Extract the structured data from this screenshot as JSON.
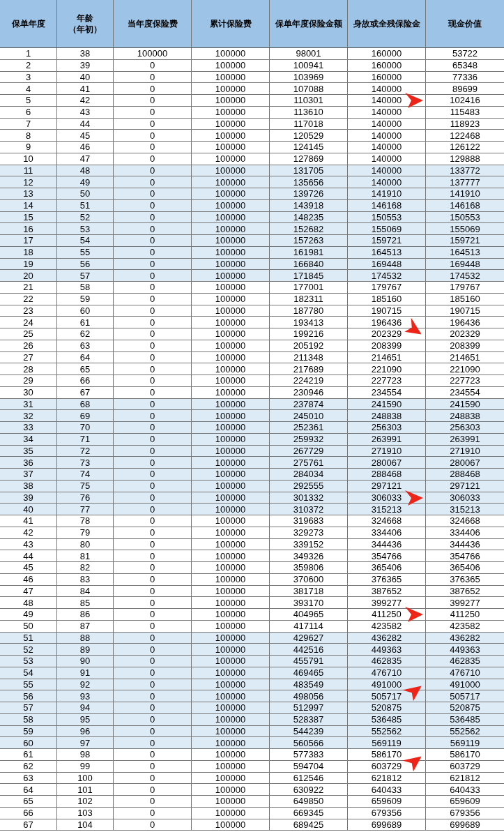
{
  "columns": [
    {
      "label": "保单年度"
    },
    {
      "label": "年龄",
      "sublabel": "（年初）"
    },
    {
      "label": "当年度保险费"
    },
    {
      "label": "累计保险费"
    },
    {
      "label": "保单年度保险金额"
    },
    {
      "label": "身故或全残保险金"
    },
    {
      "label": "现金价值"
    }
  ],
  "rows": [
    {
      "cells": [
        "1",
        "38",
        "100000",
        "100000",
        "98001",
        "160000",
        "53722"
      ],
      "shaded": false
    },
    {
      "cells": [
        "2",
        "39",
        "0",
        "100000",
        "100941",
        "160000",
        "65348"
      ],
      "shaded": false
    },
    {
      "cells": [
        "3",
        "40",
        "0",
        "100000",
        "103969",
        "160000",
        "77336"
      ],
      "shaded": false
    },
    {
      "cells": [
        "4",
        "41",
        "0",
        "100000",
        "107088",
        "140000",
        "89699"
      ],
      "shaded": false
    },
    {
      "cells": [
        "5",
        "42",
        "0",
        "100000",
        "110301",
        "140000",
        "102416"
      ],
      "shaded": false,
      "arrow": {
        "kind": "right"
      }
    },
    {
      "cells": [
        "6",
        "43",
        "0",
        "100000",
        "113610",
        "140000",
        "115483"
      ],
      "shaded": false
    },
    {
      "cells": [
        "7",
        "44",
        "0",
        "100000",
        "117018",
        "140000",
        "118923"
      ],
      "shaded": false
    },
    {
      "cells": [
        "8",
        "45",
        "0",
        "100000",
        "120529",
        "140000",
        "122468"
      ],
      "shaded": false
    },
    {
      "cells": [
        "9",
        "46",
        "0",
        "100000",
        "124145",
        "140000",
        "126122"
      ],
      "shaded": false
    },
    {
      "cells": [
        "10",
        "47",
        "0",
        "100000",
        "127869",
        "140000",
        "129888"
      ],
      "shaded": false
    },
    {
      "cells": [
        "11",
        "48",
        "0",
        "100000",
        "131705",
        "140000",
        "133772"
      ],
      "shaded": true
    },
    {
      "cells": [
        "12",
        "49",
        "0",
        "100000",
        "135656",
        "140000",
        "137777"
      ],
      "shaded": true
    },
    {
      "cells": [
        "13",
        "50",
        "0",
        "100000",
        "139726",
        "141910",
        "141910"
      ],
      "shaded": true
    },
    {
      "cells": [
        "14",
        "51",
        "0",
        "100000",
        "143918",
        "146168",
        "146168"
      ],
      "shaded": true
    },
    {
      "cells": [
        "15",
        "52",
        "0",
        "100000",
        "148235",
        "150553",
        "150553"
      ],
      "shaded": true
    },
    {
      "cells": [
        "16",
        "53",
        "0",
        "100000",
        "152682",
        "155069",
        "155069"
      ],
      "shaded": true
    },
    {
      "cells": [
        "17",
        "54",
        "0",
        "100000",
        "157263",
        "159721",
        "159721"
      ],
      "shaded": true
    },
    {
      "cells": [
        "18",
        "55",
        "0",
        "100000",
        "161981",
        "164513",
        "164513"
      ],
      "shaded": true
    },
    {
      "cells": [
        "19",
        "56",
        "0",
        "100000",
        "166840",
        "169448",
        "169448"
      ],
      "shaded": true
    },
    {
      "cells": [
        "20",
        "57",
        "0",
        "100000",
        "171845",
        "174532",
        "174532"
      ],
      "shaded": true
    },
    {
      "cells": [
        "21",
        "58",
        "0",
        "100000",
        "177001",
        "179767",
        "179767"
      ],
      "shaded": false
    },
    {
      "cells": [
        "22",
        "59",
        "0",
        "100000",
        "182311",
        "185160",
        "185160"
      ],
      "shaded": false
    },
    {
      "cells": [
        "23",
        "60",
        "0",
        "100000",
        "187780",
        "190715",
        "190715"
      ],
      "shaded": false
    },
    {
      "cells": [
        "24",
        "61",
        "0",
        "100000",
        "193413",
        "196436",
        "196436"
      ],
      "shaded": false
    },
    {
      "cells": [
        "25",
        "62",
        "0",
        "100000",
        "199216",
        "202329",
        "202329"
      ],
      "shaded": false,
      "arrow": {
        "kind": "downright"
      }
    },
    {
      "cells": [
        "26",
        "63",
        "0",
        "100000",
        "205192",
        "208399",
        "208399"
      ],
      "shaded": false
    },
    {
      "cells": [
        "27",
        "64",
        "0",
        "100000",
        "211348",
        "214651",
        "214651"
      ],
      "shaded": false
    },
    {
      "cells": [
        "28",
        "65",
        "0",
        "100000",
        "217689",
        "221090",
        "221090"
      ],
      "shaded": false
    },
    {
      "cells": [
        "29",
        "66",
        "0",
        "100000",
        "224219",
        "227723",
        "227723"
      ],
      "shaded": false
    },
    {
      "cells": [
        "30",
        "67",
        "0",
        "100000",
        "230946",
        "234554",
        "234554"
      ],
      "shaded": false
    },
    {
      "cells": [
        "31",
        "68",
        "0",
        "100000",
        "237874",
        "241590",
        "241590"
      ],
      "shaded": true
    },
    {
      "cells": [
        "32",
        "69",
        "0",
        "100000",
        "245010",
        "248838",
        "248838"
      ],
      "shaded": true
    },
    {
      "cells": [
        "33",
        "70",
        "0",
        "100000",
        "252361",
        "256303",
        "256303"
      ],
      "shaded": true
    },
    {
      "cells": [
        "34",
        "71",
        "0",
        "100000",
        "259932",
        "263991",
        "263991"
      ],
      "shaded": true
    },
    {
      "cells": [
        "35",
        "72",
        "0",
        "100000",
        "267729",
        "271910",
        "271910"
      ],
      "shaded": true
    },
    {
      "cells": [
        "36",
        "73",
        "0",
        "100000",
        "275761",
        "280067",
        "280067"
      ],
      "shaded": true
    },
    {
      "cells": [
        "37",
        "74",
        "0",
        "100000",
        "284034",
        "288468",
        "288468"
      ],
      "shaded": true
    },
    {
      "cells": [
        "38",
        "75",
        "0",
        "100000",
        "292555",
        "297121",
        "297121"
      ],
      "shaded": true
    },
    {
      "cells": [
        "39",
        "76",
        "0",
        "100000",
        "301332",
        "306033",
        "306033"
      ],
      "shaded": true,
      "arrow": {
        "kind": "right"
      }
    },
    {
      "cells": [
        "40",
        "77",
        "0",
        "100000",
        "310372",
        "315213",
        "315213"
      ],
      "shaded": true
    },
    {
      "cells": [
        "41",
        "78",
        "0",
        "100000",
        "319683",
        "324668",
        "324668"
      ],
      "shaded": false
    },
    {
      "cells": [
        "42",
        "79",
        "0",
        "100000",
        "329273",
        "334406",
        "334406"
      ],
      "shaded": false
    },
    {
      "cells": [
        "43",
        "80",
        "0",
        "100000",
        "339152",
        "344436",
        "344436"
      ],
      "shaded": false
    },
    {
      "cells": [
        "44",
        "81",
        "0",
        "100000",
        "349326",
        "354766",
        "354766"
      ],
      "shaded": false
    },
    {
      "cells": [
        "45",
        "82",
        "0",
        "100000",
        "359806",
        "365406",
        "365406"
      ],
      "shaded": false
    },
    {
      "cells": [
        "46",
        "83",
        "0",
        "100000",
        "370600",
        "376365",
        "376365"
      ],
      "shaded": false
    },
    {
      "cells": [
        "47",
        "84",
        "0",
        "100000",
        "381718",
        "387652",
        "387652"
      ],
      "shaded": false
    },
    {
      "cells": [
        "48",
        "85",
        "0",
        "100000",
        "393170",
        "399277",
        "399277"
      ],
      "shaded": false
    },
    {
      "cells": [
        "49",
        "86",
        "0",
        "100000",
        "404965",
        "411250",
        "411250"
      ],
      "shaded": false,
      "arrow": {
        "kind": "right"
      }
    },
    {
      "cells": [
        "50",
        "87",
        "0",
        "100000",
        "417114",
        "423582",
        "423582"
      ],
      "shaded": false
    },
    {
      "cells": [
        "51",
        "88",
        "0",
        "100000",
        "429627",
        "436282",
        "436282"
      ],
      "shaded": true
    },
    {
      "cells": [
        "52",
        "89",
        "0",
        "100000",
        "442516",
        "449363",
        "449363"
      ],
      "shaded": true
    },
    {
      "cells": [
        "53",
        "90",
        "0",
        "100000",
        "455791",
        "462835",
        "462835"
      ],
      "shaded": true
    },
    {
      "cells": [
        "54",
        "91",
        "0",
        "100000",
        "469465",
        "476710",
        "476710"
      ],
      "shaded": true
    },
    {
      "cells": [
        "55",
        "92",
        "0",
        "100000",
        "483549",
        "491000",
        "491000"
      ],
      "shaded": true
    },
    {
      "cells": [
        "56",
        "93",
        "0",
        "100000",
        "498056",
        "505717",
        "505717"
      ],
      "shaded": true,
      "arrow": {
        "kind": "upright"
      }
    },
    {
      "cells": [
        "57",
        "94",
        "0",
        "100000",
        "512997",
        "520875",
        "520875"
      ],
      "shaded": true
    },
    {
      "cells": [
        "58",
        "95",
        "0",
        "100000",
        "528387",
        "536485",
        "536485"
      ],
      "shaded": true
    },
    {
      "cells": [
        "59",
        "96",
        "0",
        "100000",
        "544239",
        "552562",
        "552562"
      ],
      "shaded": true
    },
    {
      "cells": [
        "60",
        "97",
        "0",
        "100000",
        "560566",
        "569119",
        "569119"
      ],
      "shaded": true
    },
    {
      "cells": [
        "61",
        "98",
        "0",
        "100000",
        "577383",
        "586170",
        "586170"
      ],
      "shaded": false
    },
    {
      "cells": [
        "62",
        "99",
        "0",
        "100000",
        "594704",
        "603729",
        "603729"
      ],
      "shaded": false,
      "arrow": {
        "kind": "upright"
      }
    },
    {
      "cells": [
        "63",
        "100",
        "0",
        "100000",
        "612546",
        "621812",
        "621812"
      ],
      "shaded": false
    },
    {
      "cells": [
        "64",
        "101",
        "0",
        "100000",
        "630922",
        "640433",
        "640433"
      ],
      "shaded": false
    },
    {
      "cells": [
        "65",
        "102",
        "0",
        "100000",
        "649850",
        "659609",
        "659609"
      ],
      "shaded": false
    },
    {
      "cells": [
        "66",
        "103",
        "0",
        "100000",
        "669345",
        "679356",
        "679356"
      ],
      "shaded": false
    },
    {
      "cells": [
        "67",
        "104",
        "0",
        "100000",
        "689425",
        "699689",
        "699689"
      ],
      "shaded": false
    }
  ]
}
